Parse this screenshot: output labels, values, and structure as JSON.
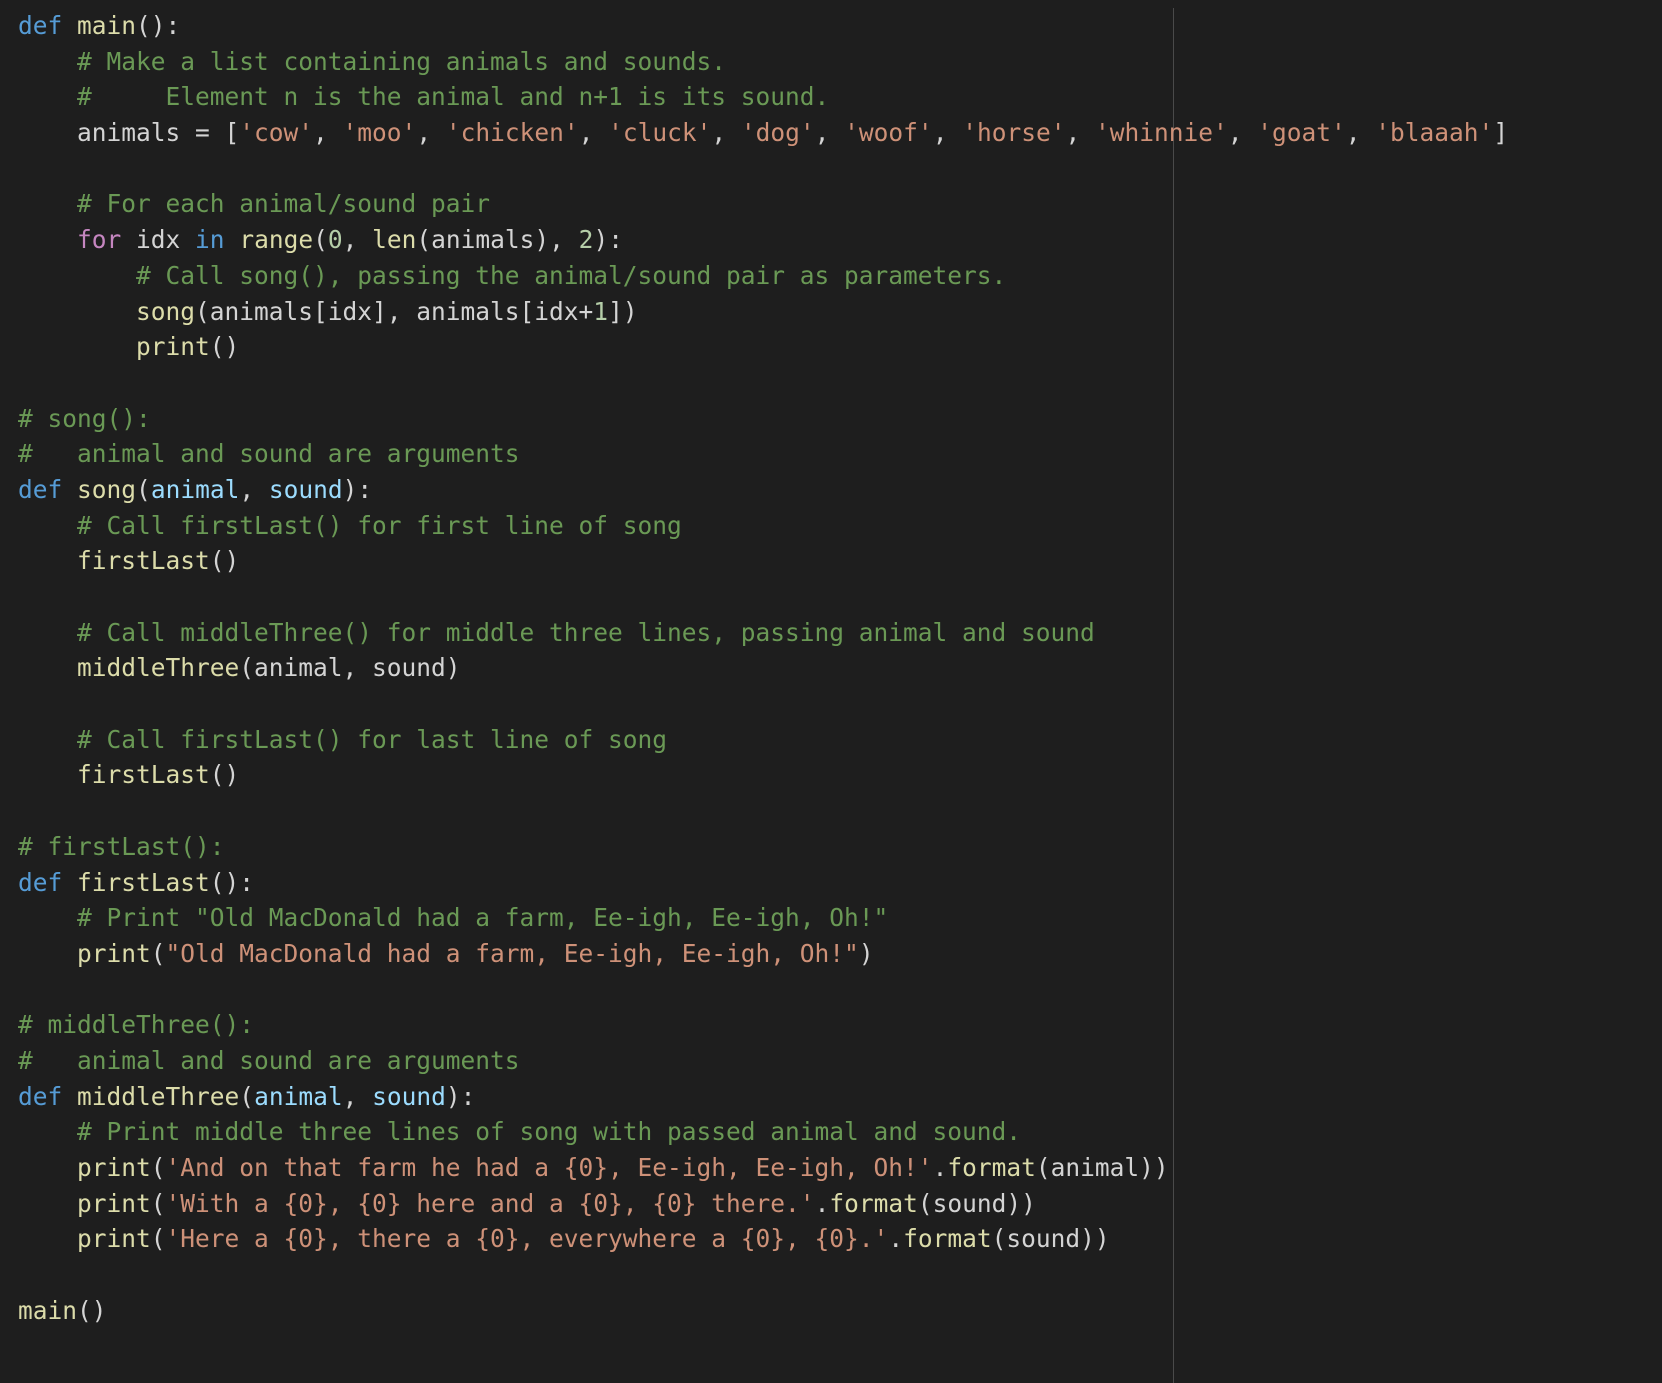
{
  "colors": {
    "background": "#1e1e1e",
    "kw": "#569cd6",
    "ctrl": "#c586c0",
    "fn": "#dcdcaa",
    "cmt": "#6a9955",
    "str": "#ce9178",
    "num": "#b5cea8",
    "param": "#9cdcfe",
    "plain": "#d4d4d4",
    "ruler": "#4a4a4a"
  },
  "code_lines": [
    [
      [
        "kw",
        "def"
      ],
      [
        "plain",
        " "
      ],
      [
        "fn",
        "main"
      ],
      [
        "plain",
        "():"
      ]
    ],
    [
      [
        "plain",
        "    "
      ],
      [
        "cmt",
        "# Make a list containing animals and sounds."
      ]
    ],
    [
      [
        "plain",
        "    "
      ],
      [
        "cmt",
        "#     Element n is the animal and n+1 is its sound."
      ]
    ],
    [
      [
        "plain",
        "    animals = ["
      ],
      [
        "str",
        "'cow'"
      ],
      [
        "plain",
        ", "
      ],
      [
        "str",
        "'moo'"
      ],
      [
        "plain",
        ", "
      ],
      [
        "str",
        "'chicken'"
      ],
      [
        "plain",
        ", "
      ],
      [
        "str",
        "'cluck'"
      ],
      [
        "plain",
        ", "
      ],
      [
        "str",
        "'dog'"
      ],
      [
        "plain",
        ", "
      ],
      [
        "str",
        "'woof'"
      ],
      [
        "plain",
        ", "
      ],
      [
        "str",
        "'horse'"
      ],
      [
        "plain",
        ", "
      ],
      [
        "str",
        "'whinnie'"
      ],
      [
        "plain",
        ", "
      ],
      [
        "str",
        "'goat'"
      ],
      [
        "plain",
        ", "
      ],
      [
        "str",
        "'blaaah'"
      ],
      [
        "plain",
        "]"
      ]
    ],
    [],
    [
      [
        "plain",
        "    "
      ],
      [
        "cmt",
        "# For each animal/sound pair"
      ]
    ],
    [
      [
        "plain",
        "    "
      ],
      [
        "ctrl",
        "for"
      ],
      [
        "plain",
        " idx "
      ],
      [
        "kw",
        "in"
      ],
      [
        "plain",
        " "
      ],
      [
        "fn",
        "range"
      ],
      [
        "plain",
        "("
      ],
      [
        "num",
        "0"
      ],
      [
        "plain",
        ", "
      ],
      [
        "fn",
        "len"
      ],
      [
        "plain",
        "(animals), "
      ],
      [
        "num",
        "2"
      ],
      [
        "plain",
        "):"
      ]
    ],
    [
      [
        "plain",
        "        "
      ],
      [
        "cmt",
        "# Call song(), passing the animal/sound pair as parameters."
      ]
    ],
    [
      [
        "plain",
        "        "
      ],
      [
        "fn",
        "song"
      ],
      [
        "plain",
        "(animals[idx], animals[idx+"
      ],
      [
        "num",
        "1"
      ],
      [
        "plain",
        "])"
      ]
    ],
    [
      [
        "plain",
        "        "
      ],
      [
        "fn",
        "print"
      ],
      [
        "plain",
        "()"
      ]
    ],
    [],
    [
      [
        "cmt",
        "# song():"
      ]
    ],
    [
      [
        "cmt",
        "#   animal and sound are arguments"
      ]
    ],
    [
      [
        "kw",
        "def"
      ],
      [
        "plain",
        " "
      ],
      [
        "fn",
        "song"
      ],
      [
        "plain",
        "("
      ],
      [
        "param",
        "animal"
      ],
      [
        "plain",
        ", "
      ],
      [
        "param",
        "sound"
      ],
      [
        "plain",
        "):"
      ]
    ],
    [
      [
        "plain",
        "    "
      ],
      [
        "cmt",
        "# Call firstLast() for first line of song"
      ]
    ],
    [
      [
        "plain",
        "    "
      ],
      [
        "fn",
        "firstLast"
      ],
      [
        "plain",
        "()"
      ]
    ],
    [],
    [
      [
        "plain",
        "    "
      ],
      [
        "cmt",
        "# Call middleThree() for middle three lines, passing animal and sound"
      ]
    ],
    [
      [
        "plain",
        "    "
      ],
      [
        "fn",
        "middleThree"
      ],
      [
        "plain",
        "(animal, sound)"
      ]
    ],
    [],
    [
      [
        "plain",
        "    "
      ],
      [
        "cmt",
        "# Call firstLast() for last line of song"
      ]
    ],
    [
      [
        "plain",
        "    "
      ],
      [
        "fn",
        "firstLast"
      ],
      [
        "plain",
        "()"
      ]
    ],
    [],
    [
      [
        "cmt",
        "# firstLast():"
      ]
    ],
    [
      [
        "kw",
        "def"
      ],
      [
        "plain",
        " "
      ],
      [
        "fn",
        "firstLast"
      ],
      [
        "plain",
        "():"
      ]
    ],
    [
      [
        "plain",
        "    "
      ],
      [
        "cmt",
        "# Print \"Old MacDonald had a farm, Ee-igh, Ee-igh, Oh!\""
      ]
    ],
    [
      [
        "plain",
        "    "
      ],
      [
        "fn",
        "print"
      ],
      [
        "plain",
        "("
      ],
      [
        "str",
        "\"Old MacDonald had a farm, Ee-igh, Ee-igh, Oh!\""
      ],
      [
        "plain",
        ")"
      ]
    ],
    [],
    [
      [
        "cmt",
        "# middleThree():"
      ]
    ],
    [
      [
        "cmt",
        "#   animal and sound are arguments"
      ]
    ],
    [
      [
        "kw",
        "def"
      ],
      [
        "plain",
        " "
      ],
      [
        "fn",
        "middleThree"
      ],
      [
        "plain",
        "("
      ],
      [
        "param",
        "animal"
      ],
      [
        "plain",
        ", "
      ],
      [
        "param",
        "sound"
      ],
      [
        "plain",
        "):"
      ]
    ],
    [
      [
        "plain",
        "    "
      ],
      [
        "cmt",
        "# Print middle three lines of song with passed animal and sound."
      ]
    ],
    [
      [
        "plain",
        "    "
      ],
      [
        "fn",
        "print"
      ],
      [
        "plain",
        "("
      ],
      [
        "str",
        "'And on that farm he had a {0}, Ee-igh, Ee-igh, Oh!'"
      ],
      [
        "plain",
        "."
      ],
      [
        "fn",
        "format"
      ],
      [
        "plain",
        "(animal))"
      ]
    ],
    [
      [
        "plain",
        "    "
      ],
      [
        "fn",
        "print"
      ],
      [
        "plain",
        "("
      ],
      [
        "str",
        "'With a {0}, {0} here and a {0}, {0} there.'"
      ],
      [
        "plain",
        "."
      ],
      [
        "fn",
        "format"
      ],
      [
        "plain",
        "(sound))"
      ]
    ],
    [
      [
        "plain",
        "    "
      ],
      [
        "fn",
        "print"
      ],
      [
        "plain",
        "("
      ],
      [
        "str",
        "'Here a {0}, there a {0}, everywhere a {0}, {0}.'"
      ],
      [
        "plain",
        "."
      ],
      [
        "fn",
        "format"
      ],
      [
        "plain",
        "(sound))"
      ]
    ],
    [],
    [
      [
        "fn",
        "main"
      ],
      [
        "plain",
        "()"
      ]
    ]
  ]
}
